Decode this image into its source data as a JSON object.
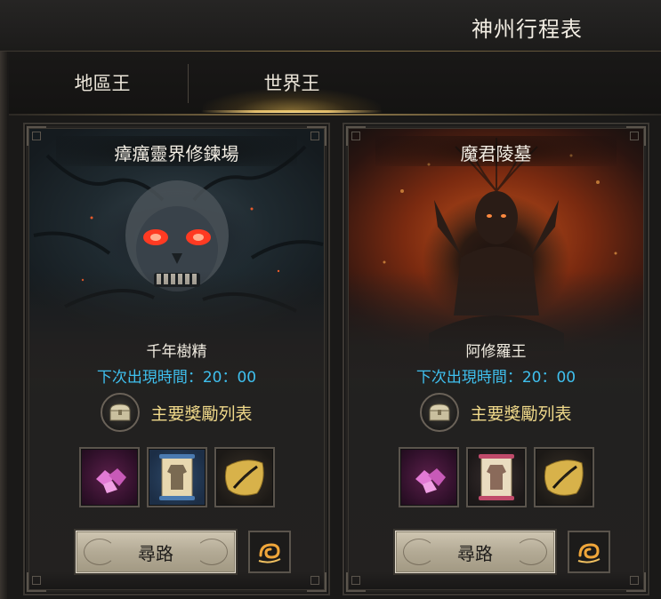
{
  "header": {
    "title": "神州行程表"
  },
  "tabs": [
    {
      "label": "地區王",
      "active": false
    },
    {
      "label": "世界王",
      "active": true
    }
  ],
  "bosses": [
    {
      "location": "瘴癘靈界修鍊場",
      "name": "千年樹精",
      "spawn_text": "下次出現時間：20：00",
      "reward_label": "主要獎勵列表",
      "rewards": [
        "purple-gem-icon",
        "armor-scroll-icon",
        "gold-feather-icon"
      ],
      "path_label": "尋路",
      "theme": "forest-dark"
    },
    {
      "location": "魔君陵墓",
      "name": "阿修羅王",
      "spawn_text": "下次出現時間：20：00",
      "reward_label": "主要獎勵列表",
      "rewards": [
        "purple-gem-icon",
        "armor-scroll-icon",
        "gold-feather-icon"
      ],
      "path_label": "尋路",
      "theme": "fire-orange"
    }
  ],
  "colors": {
    "accent_gold": "#e4c278",
    "spawn_blue": "#3fc0ee",
    "reward_text": "#f0d98a"
  }
}
